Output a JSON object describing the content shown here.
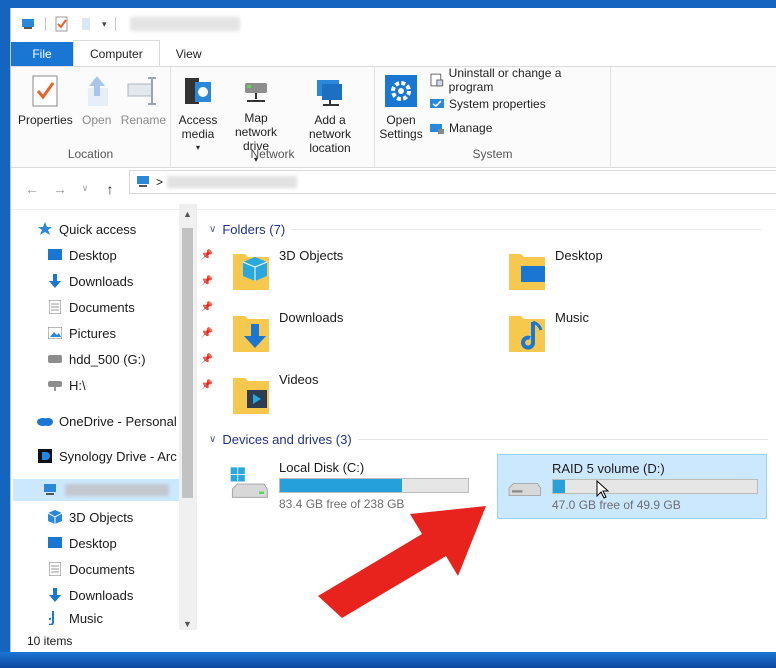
{
  "ribbon": {
    "tabs": [
      "File",
      "Computer",
      "View"
    ],
    "location_group": {
      "label": "Location",
      "buttons": [
        "Properties",
        "Open",
        "Rename"
      ]
    },
    "network_group": {
      "label": "Network",
      "buttons": [
        "Access media",
        "Map network drive",
        "Add a network location"
      ]
    },
    "system_group": {
      "label": "System",
      "open_settings": "Open Settings",
      "small_buttons": [
        "Uninstall or change a program",
        "System properties",
        "Manage"
      ]
    }
  },
  "address": {
    "separator": ">"
  },
  "navpane": {
    "quick_access": "Quick access",
    "pinned": [
      "Desktop",
      "Downloads",
      "Documents",
      "Pictures",
      "hdd_500 (G:)",
      "H:\\"
    ],
    "onedrive": "OneDrive - Personal",
    "synology": "Synology Drive - Arc",
    "this_pc_children": [
      "3D Objects",
      "Desktop",
      "Documents",
      "Downloads",
      "Music"
    ]
  },
  "main": {
    "folders_header": "Folders (7)",
    "folders": [
      "3D Objects",
      "Desktop",
      "Downloads",
      "Music",
      "Videos"
    ],
    "devices_header": "Devices and drives (3)",
    "drives": [
      {
        "name": "Local Disk (C:)",
        "free": "83.4 GB free of 238 GB",
        "used_fraction": 0.65
      },
      {
        "name": "RAID 5 volume (D:)",
        "free": "47.0 GB free of 49.9 GB",
        "used_fraction": 0.06
      }
    ]
  },
  "status": {
    "items": "10 items"
  },
  "colors": {
    "accent": "#1976d2",
    "selection": "#cce8ff",
    "drive_fill": "#26a0da",
    "arrow": "#e8231e"
  }
}
